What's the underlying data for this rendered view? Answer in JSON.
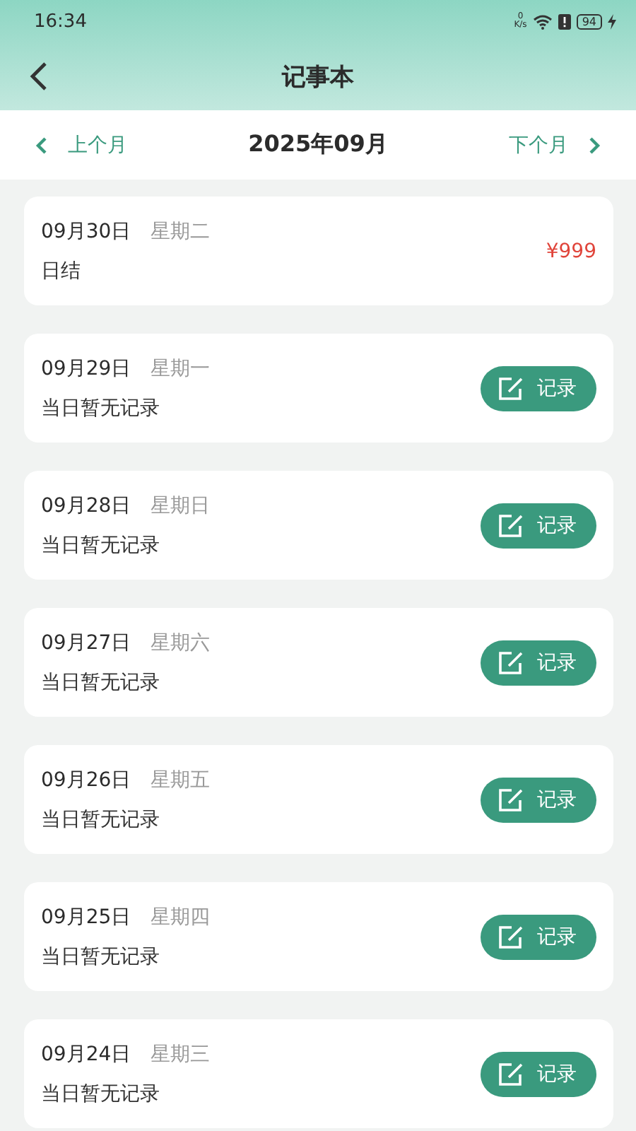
{
  "status_bar": {
    "time": "16:34",
    "speed_value": "0",
    "speed_unit": "K/s",
    "battery": "94"
  },
  "header": {
    "title": "记事本"
  },
  "month_bar": {
    "prev": "上个月",
    "current": "2025年09月",
    "next": "下个月"
  },
  "entries": [
    {
      "kind": "amount",
      "date": "09月30日",
      "weekday": "星期二",
      "note": "日结",
      "amount": "¥999"
    },
    {
      "kind": "button",
      "date": "09月29日",
      "weekday": "星期一",
      "note": "当日暂无记录",
      "button": "记录"
    },
    {
      "kind": "button",
      "date": "09月28日",
      "weekday": "星期日",
      "note": "当日暂无记录",
      "button": "记录"
    },
    {
      "kind": "button",
      "date": "09月27日",
      "weekday": "星期六",
      "note": "当日暂无记录",
      "button": "记录"
    },
    {
      "kind": "button",
      "date": "09月26日",
      "weekday": "星期五",
      "note": "当日暂无记录",
      "button": "记录"
    },
    {
      "kind": "button",
      "date": "09月25日",
      "weekday": "星期四",
      "note": "当日暂无记录",
      "button": "记录"
    },
    {
      "kind": "button",
      "date": "09月24日",
      "weekday": "星期三",
      "note": "当日暂无记录",
      "button": "记录"
    }
  ]
}
